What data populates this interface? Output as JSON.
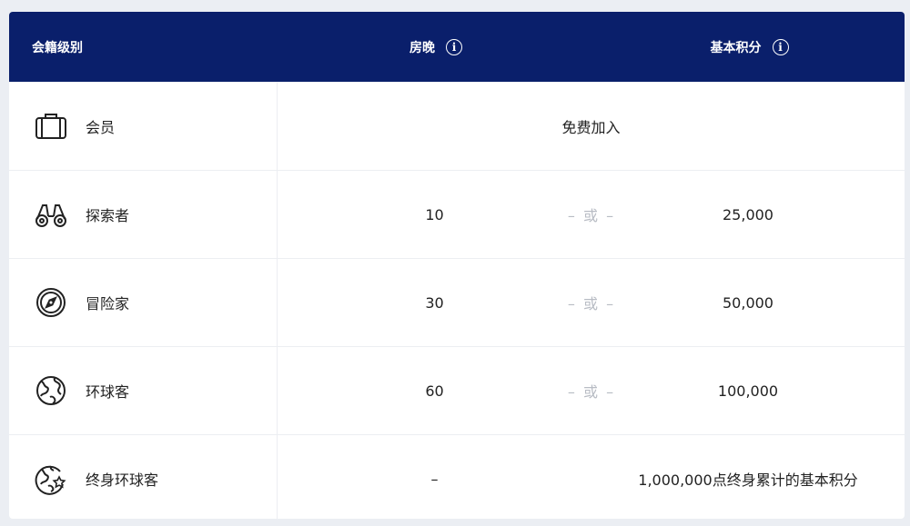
{
  "header": {
    "level_label": "会籍级别",
    "nights_label": "房晚",
    "points_label": "基本积分",
    "info_glyph": "i"
  },
  "rows": [
    {
      "level": "会员",
      "icon": "suitcase-icon",
      "free": "免费加入"
    },
    {
      "level": "探索者",
      "icon": "binoculars-icon",
      "nights": "10",
      "or": "– 或 –",
      "points": "25,000"
    },
    {
      "level": "冒险家",
      "icon": "compass-icon",
      "nights": "30",
      "or": "– 或 –",
      "points": "50,000"
    },
    {
      "level": "环球客",
      "icon": "globe-icon",
      "nights": "60",
      "or": "– 或 –",
      "points": "100,000"
    },
    {
      "level": "终身环球客",
      "icon": "globe-star-icon",
      "nights": "–",
      "points": "1,000,000点终身累计的基本积分"
    }
  ],
  "colors": {
    "header_bg": "#0a1f6b",
    "or_text": "#b8bcc4",
    "page_bg": "#ebeef3"
  }
}
